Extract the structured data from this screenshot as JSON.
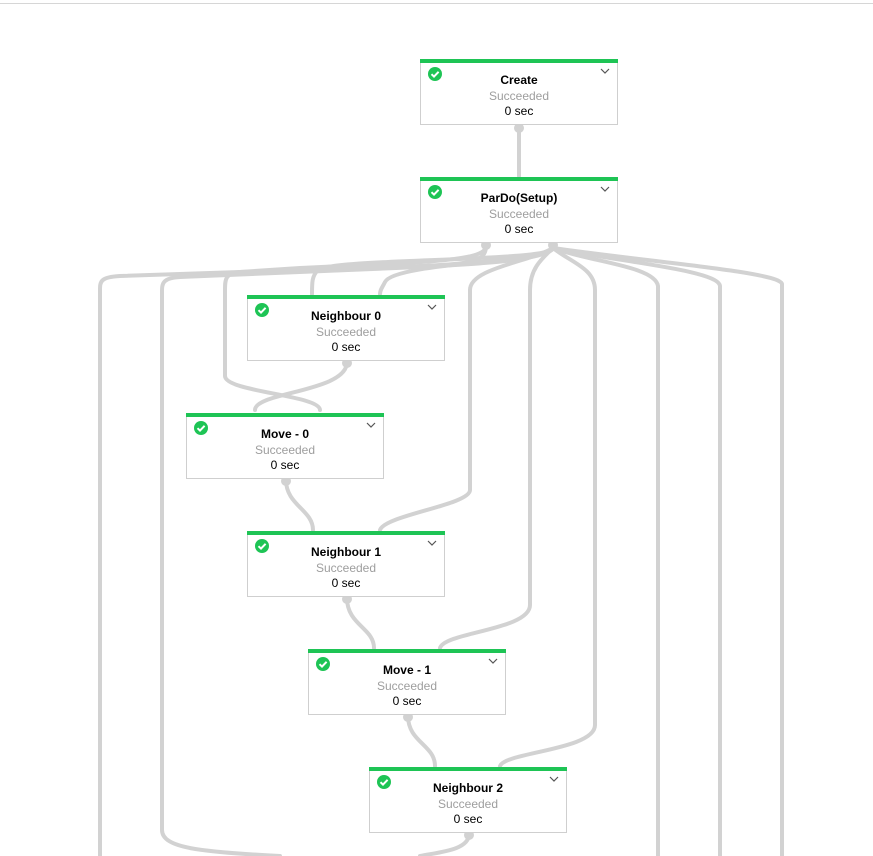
{
  "graph": {
    "status_color": "#1ec455",
    "edge_color": "#d2d2d2",
    "nodes": [
      {
        "id": "create",
        "title": "Create",
        "status": "Succeeded",
        "time": "0 sec",
        "icon": "check-circle-icon"
      },
      {
        "id": "pardo-setup",
        "title": "ParDo(Setup)",
        "status": "Succeeded",
        "time": "0 sec",
        "icon": "check-circle-icon"
      },
      {
        "id": "neighbour-0",
        "title": "Neighbour 0",
        "status": "Succeeded",
        "time": "0 sec",
        "icon": "check-circle-icon"
      },
      {
        "id": "move-0",
        "title": "Move - 0",
        "status": "Succeeded",
        "time": "0 sec",
        "icon": "check-circle-icon"
      },
      {
        "id": "neighbour-1",
        "title": "Neighbour 1",
        "status": "Succeeded",
        "time": "0 sec",
        "icon": "check-circle-icon"
      },
      {
        "id": "move-1",
        "title": "Move - 1",
        "status": "Succeeded",
        "time": "0 sec",
        "icon": "check-circle-icon"
      },
      {
        "id": "neighbour-2",
        "title": "Neighbour 2",
        "status": "Succeeded",
        "time": "0 sec",
        "icon": "check-circle-icon"
      }
    ],
    "edges": [
      [
        "create",
        "pardo-setup"
      ],
      [
        "pardo-setup",
        "neighbour-0"
      ],
      [
        "pardo-setup",
        "move-0"
      ],
      [
        "pardo-setup",
        "neighbour-1"
      ],
      [
        "pardo-setup",
        "move-1"
      ],
      [
        "pardo-setup",
        "neighbour-2"
      ],
      [
        "neighbour-0",
        "move-0"
      ],
      [
        "move-0",
        "neighbour-1"
      ],
      [
        "neighbour-1",
        "move-1"
      ],
      [
        "move-1",
        "neighbour-2"
      ]
    ]
  }
}
